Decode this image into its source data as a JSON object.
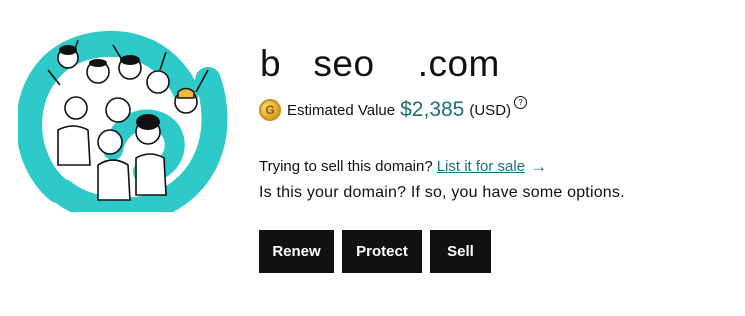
{
  "domain": {
    "name": "b   seo    .com"
  },
  "valuation": {
    "badge_letter": "G",
    "label": "Estimated Value",
    "amount": "$2,385",
    "currency": "(USD)",
    "help_symbol": "?"
  },
  "sell_prompt": {
    "question": "Trying to sell this domain?",
    "link_label": "List it for sale",
    "arrow": "→"
  },
  "ownership_prompt": "Is this your domain? If so, you have some options.",
  "actions": {
    "renew_label": "Renew",
    "protect_label": "Protect",
    "sell_label": "Sell"
  },
  "colors": {
    "accent_teal": "#1b6f7a",
    "illustration_teal": "#2ec9c9",
    "button_bg": "#111111",
    "button_text": "#ffffff"
  },
  "icons": {
    "badge": "gold-coin-g-icon",
    "help": "question-circle-icon",
    "arrow": "arrow-right-icon",
    "illustration": "crowd-celebrating-illustration"
  }
}
